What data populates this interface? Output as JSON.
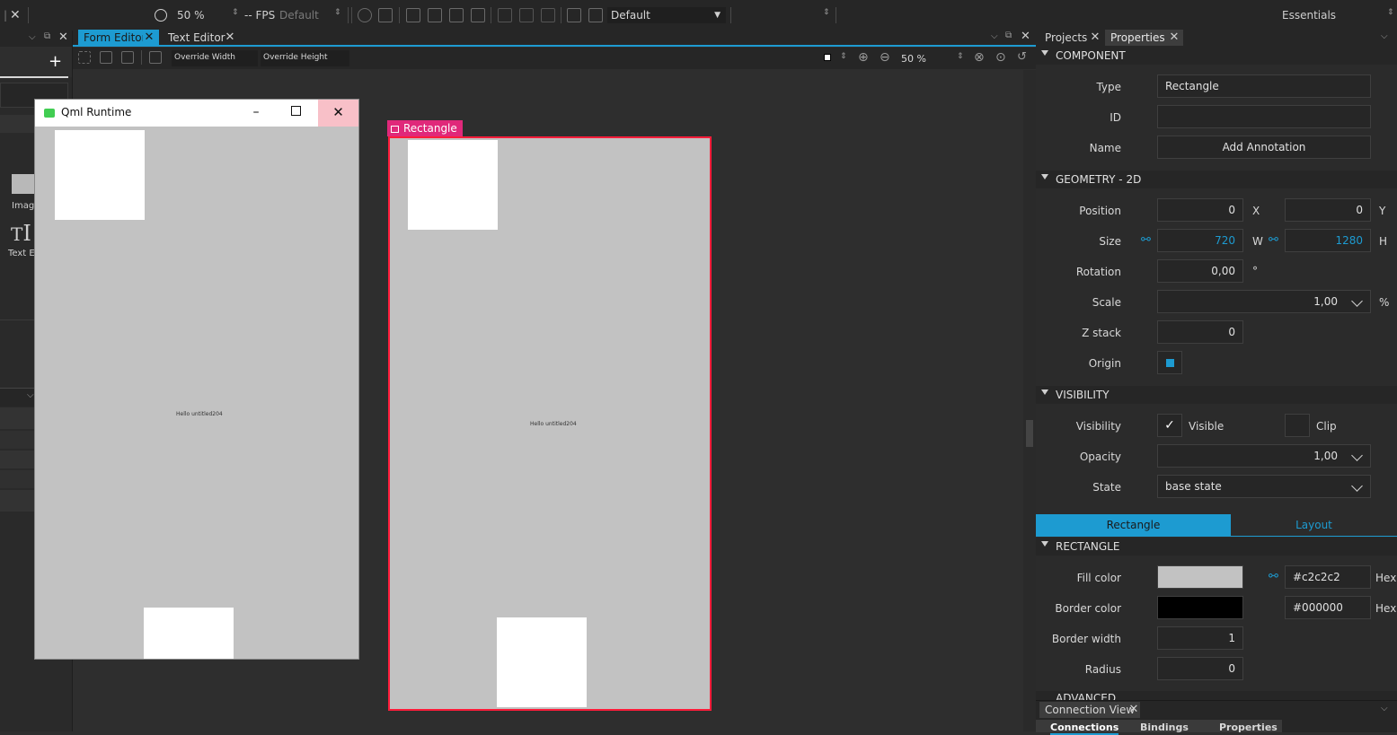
{
  "toolbar": {
    "zoom": "50 %",
    "fps": "-- FPS",
    "fps_mode": "Default",
    "style": "Default",
    "workspace": "Essentials"
  },
  "editor_tabs": {
    "form_editor": "Form Editor",
    "text_editor": "Text Editor"
  },
  "form_toolbar": {
    "override_width": "Override Width",
    "override_height": "Override Height",
    "zoom": "50 %"
  },
  "library": {
    "plus": "+",
    "items": [
      {
        "label": "Image",
        "icon": "image-icon"
      },
      {
        "label": "Text Ed",
        "icon": "text-edit-icon"
      }
    ]
  },
  "qml_runtime": {
    "title": "Qml Runtime",
    "hello_text": "Hello untitled204"
  },
  "canvas": {
    "selection_label": "Rectangle",
    "hello_text": "Hello untitled204"
  },
  "right_tabs": {
    "projects": "Projects",
    "properties": "Properties"
  },
  "properties": {
    "component": {
      "title": "COMPONENT",
      "type_label": "Type",
      "type_value": "Rectangle",
      "id_label": "ID",
      "id_value": "",
      "name_label": "Name",
      "annotation_button": "Add Annotation"
    },
    "geometry": {
      "title": "GEOMETRY - 2D",
      "position_label": "Position",
      "x": "0",
      "x_unit": "X",
      "y": "0",
      "y_unit": "Y",
      "size_label": "Size",
      "w": "720",
      "w_unit": "W",
      "h": "1280",
      "h_unit": "H",
      "rotation_label": "Rotation",
      "rotation": "0,00",
      "rotation_unit": "°",
      "scale_label": "Scale",
      "scale": "1,00",
      "scale_unit": "%",
      "zstack_label": "Z stack",
      "zstack": "0",
      "origin_label": "Origin"
    },
    "visibility": {
      "title": "VISIBILITY",
      "visibility_label": "Visibility",
      "visible": "Visible",
      "clip": "Clip",
      "opacity_label": "Opacity",
      "opacity": "1,00",
      "state_label": "State",
      "state": "base state"
    },
    "subtabs": {
      "rectangle": "Rectangle",
      "layout": "Layout"
    },
    "rectangle": {
      "title": "RECTANGLE",
      "fill_label": "Fill color",
      "fill_hex": "#c2c2c2",
      "fill_color": "#c2c2c2",
      "border_label": "Border color",
      "border_hex": "#000000",
      "border_color": "#000000",
      "hex": "Hex",
      "border_width_label": "Border width",
      "border_width": "1",
      "radius_label": "Radius",
      "radius": "0"
    },
    "advanced_title": "ADVANCED"
  },
  "connection_view": {
    "title": "Connection View",
    "tabs": [
      "Connections",
      "Bindings",
      "Properties"
    ]
  },
  "colors": {
    "accent": "#1d9bd1",
    "selection": "#e0287a",
    "selection_border": "#ff1c3a",
    "close_hover": "#f8c0c8"
  }
}
